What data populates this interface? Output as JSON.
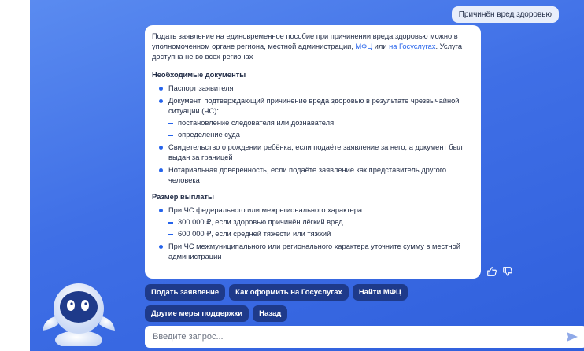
{
  "user_message": "Причинён вред здоровью",
  "bot_message": {
    "intro_pre": "Подать заявление на единовременное пособие при причинении вреда здоровью можно в уполномоченном органе региона, местной администрации, ",
    "link_mfc": "МФЦ",
    "intro_or": " или ",
    "link_gosuslugi": "на Госуслугах",
    "intro_post": ". Услуга доступна не во всех регионах",
    "docs_title": "Необходимые документы",
    "docs": [
      "Паспорт заявителя",
      "Документ, подтверждающий причинение вреда здоровью в результате чрезвычайной ситуации (ЧС):",
      "Свидетельство о рождении ребёнка, если подаёте заявление за него, а документ был выдан за границей",
      "Нотариальная доверенность, если подаёте заявление как представитель другого человека"
    ],
    "docs_sub": [
      "постановление следователя или дознавателя",
      "определение суда"
    ],
    "pay_title": "Размер выплаты",
    "pay": [
      "При ЧС федерального или межрегионального характера:",
      "При ЧС межмуниципального или регионального характера уточните сумму в местной администрации"
    ],
    "pay_sub": [
      "300 000 ₽, если здоровью причинён лёгкий вред",
      "600 000 ₽, если средней тяжести или тяжкий"
    ]
  },
  "chips": {
    "submit": "Подать заявление",
    "how_gosuslugi": "Как оформить на Госуслугах",
    "find_mfc": "Найти МФЦ",
    "other_support": "Другие меры поддержки",
    "back": "Назад"
  },
  "input": {
    "placeholder": "Введите запрос..."
  },
  "colors": {
    "background_gradient_start": "#5a8bf0",
    "background_gradient_end": "#2f5fdc",
    "chip": "#1e3a8a",
    "accent": "#2563eb"
  }
}
